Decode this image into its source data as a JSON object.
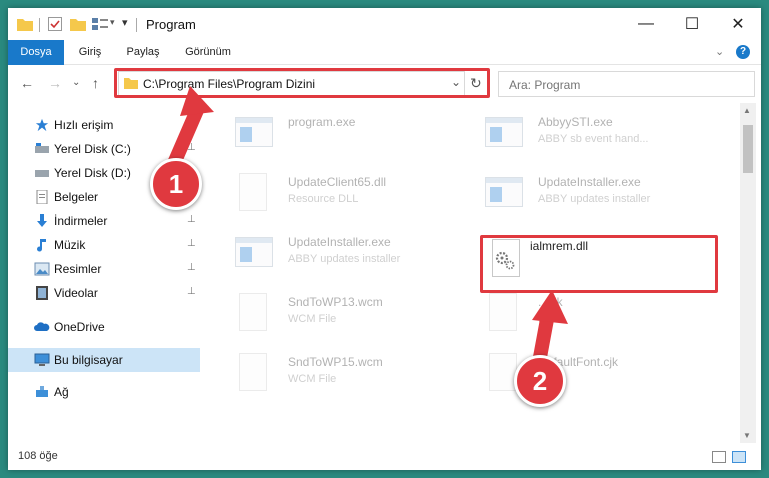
{
  "window": {
    "title": "Program",
    "controls": {
      "minimize": "—",
      "maximize": "☐",
      "close": "✕"
    }
  },
  "ribbon": {
    "tabs": [
      "Dosya",
      "Giriş",
      "Paylaş",
      "Görünüm"
    ],
    "help": "?"
  },
  "address": {
    "path": "C:\\Program Files\\Program Dizini",
    "dropdown": "⌄",
    "refresh": "↻"
  },
  "search": {
    "placeholder": "Ara: Program"
  },
  "nav": {
    "back": "←",
    "forward": "→",
    "recent": "⌄",
    "up": "↑"
  },
  "sidebar": {
    "items": [
      {
        "label": "Hızlı erişim",
        "icon": "star-icon"
      },
      {
        "label": "Yerel Disk (C:)",
        "icon": "drive-icon",
        "pinned": true
      },
      {
        "label": "Yerel Disk (D:)",
        "icon": "drive-icon",
        "pinned": true
      },
      {
        "label": "Belgeler",
        "icon": "documents-icon",
        "pinned": true
      },
      {
        "label": "İndirmeler",
        "icon": "download-icon",
        "pinned": true
      },
      {
        "label": "Müzik",
        "icon": "music-icon",
        "pinned": true
      },
      {
        "label": "Resimler",
        "icon": "pictures-icon",
        "pinned": true
      },
      {
        "label": "Videolar",
        "icon": "videos-icon",
        "pinned": true
      },
      {
        "label": "OneDrive",
        "icon": "cloud-icon"
      },
      {
        "label": "Bu bilgisayar",
        "icon": "computer-icon",
        "selected": true
      },
      {
        "label": "Ağ",
        "icon": "network-icon"
      }
    ],
    "pin_glyph": "📌"
  },
  "files": [
    {
      "name": "program.exe",
      "type": ""
    },
    {
      "name": "AbbyySTI.exe",
      "type": "ABBY sb event hand..."
    },
    {
      "name": "UpdateClient65.dll",
      "type": "Resource DLL"
    },
    {
      "name": "UpdateInstaller.exe",
      "type": "ABBY updates installer"
    },
    {
      "name": "UpdateInstaller.exe",
      "type": "ABBY updates installer"
    },
    {
      "name": "ialmrem.dll",
      "type": ""
    },
    {
      "name": "SndToWP13.wcm",
      "type": "WCM File"
    },
    {
      "name": "...cjk",
      "type": "...File"
    },
    {
      "name": "SndToWP15.wcm",
      "type": "WCM File"
    },
    {
      "name": "DefaultFont.cjk",
      "type": "...e"
    }
  ],
  "status": {
    "count": "108 öğe"
  },
  "callouts": {
    "step1": "1",
    "step2": "2"
  },
  "colors": {
    "accent": "#1979ca",
    "highlight": "#e0393f",
    "selection": "#cce4f7"
  }
}
